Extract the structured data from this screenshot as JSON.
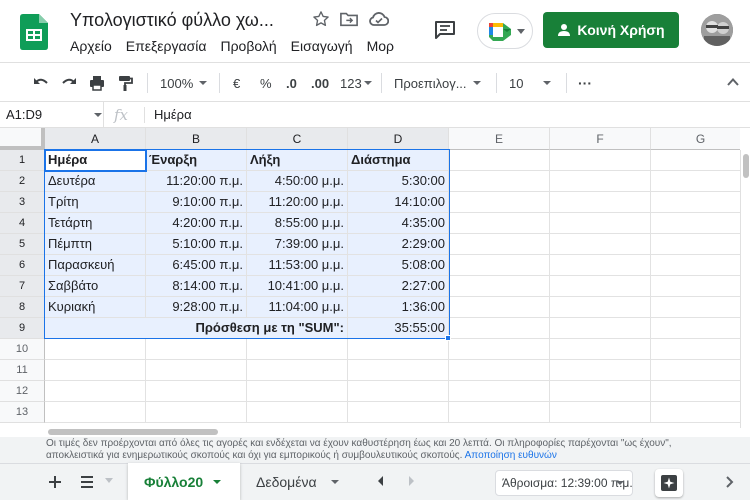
{
  "app": {
    "title": "Υπολογιστικό φύλλο χω...",
    "brand_color": "#188038",
    "accent_color": "#1a73e8"
  },
  "menu": [
    "Αρχείο",
    "Επεξεργασία",
    "Προβολή",
    "Εισαγωγή",
    "Μορ"
  ],
  "header": {
    "share_label": "Κοινή Χρήση",
    "icons": [
      "star-icon",
      "move-to-folder-icon",
      "cloud-status-icon",
      "comment-icon",
      "meet-icon",
      "share-person-icon",
      "avatar"
    ]
  },
  "toolbar": {
    "zoom": "100%",
    "currency": "€",
    "percent": "%",
    "decrease_decimal": ".0",
    "increase_decimal": ".00",
    "more_formats": "123",
    "font": "Προεπιλογ...",
    "font_size": "10",
    "more": "···"
  },
  "formula_bar": {
    "name_box": "A1:D9",
    "fx": "fx",
    "value": "Ημέρα"
  },
  "grid": {
    "columns": [
      "A",
      "B",
      "C",
      "D",
      "E",
      "F",
      "G"
    ],
    "rows": [
      "1",
      "2",
      "3",
      "4",
      "5",
      "6",
      "7",
      "8",
      "9",
      "10",
      "11",
      "12",
      "13"
    ],
    "header_row": [
      "Ημέρα",
      "Έναρξη",
      "Λήξη",
      "Διάστημα"
    ],
    "data_rows": [
      [
        "Δευτέρα",
        "11:20:00 π.μ.",
        "4:50:00 μ.μ.",
        "5:30:00"
      ],
      [
        "Τρίτη",
        "9:10:00 π.μ.",
        "11:20:00 μ.μ.",
        "14:10:00"
      ],
      [
        "Τετάρτη",
        "4:20:00 π.μ.",
        "8:55:00 μ.μ.",
        "4:35:00"
      ],
      [
        "Πέμπτη",
        "5:10:00 π.μ.",
        "7:39:00 μ.μ.",
        "2:29:00"
      ],
      [
        "Παρασκευή",
        "6:45:00 π.μ.",
        "11:53:00 μ.μ.",
        "5:08:00"
      ],
      [
        "Σαββάτο",
        "8:14:00 π.μ.",
        "10:41:00 μ.μ.",
        "2:27:00"
      ],
      [
        "Κυριακή",
        "9:28:00 π.μ.",
        "11:04:00 μ.μ.",
        "1:36:00"
      ]
    ],
    "sum_label": "Πρόσθεση με τη \"SUM\":",
    "sum_value": "35:55:00"
  },
  "disclaimer": {
    "text": "Οι τιμές δεν προέρχονται από όλες τις αγορές και ενδέχεται να έχουν καθυστέρηση έως και 20 λεπτά. Οι πληροφορίες παρέχονται \"ως έχουν\", αποκλειστικά για ενημερωτικούς σκοπούς και όχι για εμπορικούς ή συμβουλευτικούς σκοπούς.",
    "link": "Αποποίηση ευθυνών"
  },
  "sheets": {
    "active_tab": "Φύλλο20",
    "other_tab": "Δεδομένα",
    "sum_readout": "Άθροισμα: 12:39:00 π.μ."
  }
}
